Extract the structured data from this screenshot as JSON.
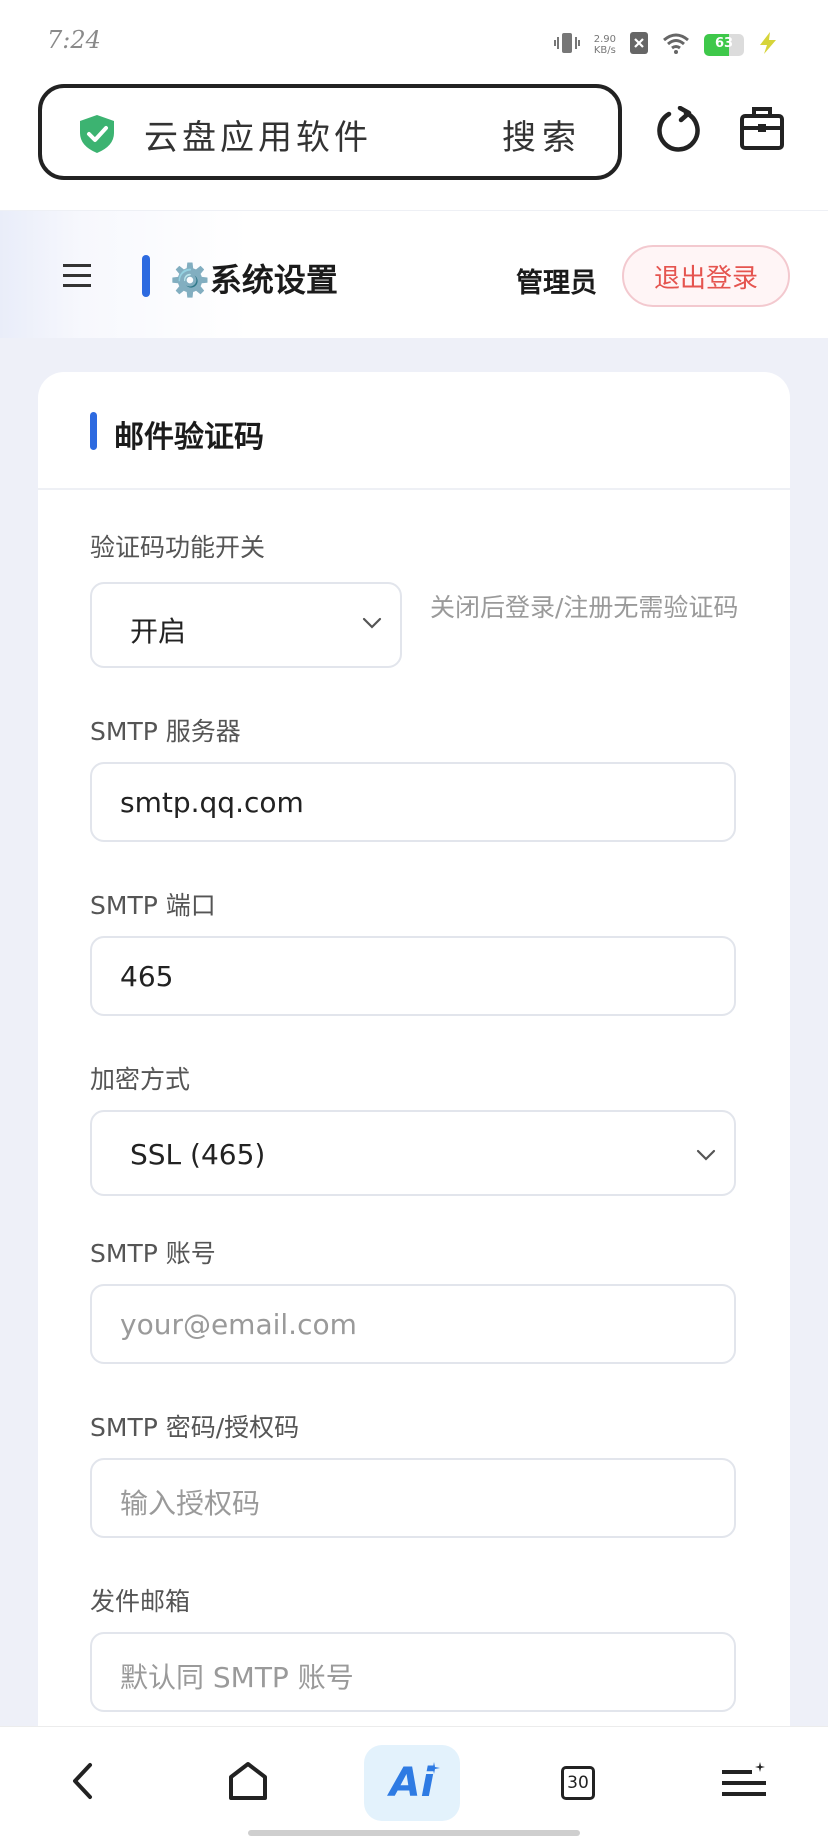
{
  "status": {
    "time": "7:24",
    "speed_top": "2.90",
    "speed_unit": "KB/s",
    "battery": "63"
  },
  "browser": {
    "url_text": "云盘应用软件",
    "search_label": "搜索"
  },
  "header": {
    "title": "⚙️系统设置",
    "admin": "管理员",
    "logout": "退出登录"
  },
  "card": {
    "title": "邮件验证码",
    "toggle": {
      "label": "验证码功能开关",
      "value": "开启",
      "hint": "关闭后登录/注册无需验证码"
    },
    "smtp_server": {
      "label": "SMTP 服务器",
      "value": "smtp.qq.com"
    },
    "smtp_port": {
      "label": "SMTP 端口",
      "value": "465"
    },
    "encryption": {
      "label": "加密方式",
      "value": "SSL (465)"
    },
    "smtp_account": {
      "label": "SMTP 账号",
      "placeholder": "your@email.com"
    },
    "smtp_password": {
      "label": "SMTP 密码/授权码",
      "placeholder": "输入授权码"
    },
    "sender_email": {
      "label": "发件邮箱",
      "placeholder": "默认同 SMTP 账号"
    }
  },
  "bottom_nav": {
    "ai_label": "Ai",
    "tabs_count": "30"
  },
  "colors": {
    "accent": "#2d6ae0",
    "logout_text": "#e5544f",
    "shield": "#3cb371"
  }
}
